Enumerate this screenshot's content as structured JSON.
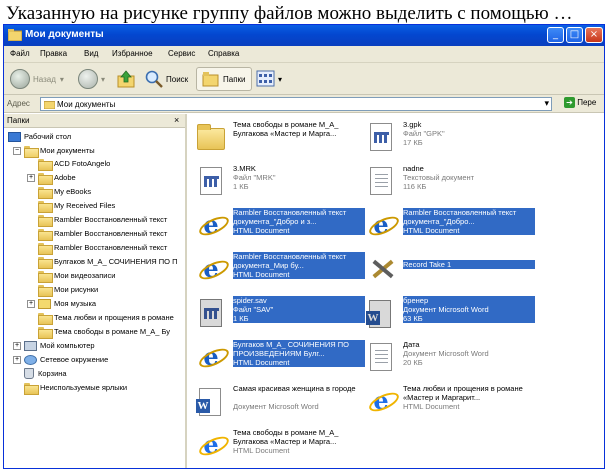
{
  "question": "Указанную на рисунке группу файлов можно выделить с помощью …",
  "window": {
    "title": "Мои документы",
    "controls": {
      "minimize": "_",
      "maximize": "□",
      "close": "×"
    }
  },
  "menu": [
    "Файл",
    "Правка",
    "Вид",
    "Избранное",
    "Сервис",
    "Справка"
  ],
  "toolbar": {
    "back": "Назад",
    "search": "Поиск",
    "folders": "Папки"
  },
  "address": {
    "label": "Адрес",
    "value": "Мои документы",
    "go": "Пере"
  },
  "left_pane": {
    "title": "Папки",
    "close": "×",
    "tree": [
      "Рабочий стол",
      "Мои документы",
      "ACD FotoAngelo",
      "Adobe",
      "My eBooks",
      "My Received Files",
      "Rambler Восстановленный текст",
      "Rambler Восстановленный текст",
      "Rambler Восстановленный текст",
      "Булгаков М_А_ СОЧИНЕНИЯ ПО П",
      "Мои видеозаписи",
      "Мои рисунки",
      "Моя музыка",
      "Тема любви и прощения в романе",
      "Тема свободы в романе М_А_ Бу",
      "Мой компьютер",
      "Сетевое окружение",
      "Корзина",
      "Неиспользуемые ярлыки"
    ]
  },
  "files": [
    {
      "name": "Тема свободы в романе М_А_ Булгакова «Мастер и Марга...",
      "type": "",
      "size": "",
      "icon": "folder-icon",
      "selected": false
    },
    {
      "name": "3.gpk",
      "type": "Файл \"GPK\"",
      "size": "17 КБ",
      "icon": "grid-file-icon",
      "selected": false
    },
    {
      "name": "3.MRK",
      "type": "Файл \"MRK\"",
      "size": "1 КБ",
      "icon": "grid-file-icon",
      "selected": false
    },
    {
      "name": "nadne",
      "type": "Текстовый документ",
      "size": "116 КБ",
      "icon": "text-file-icon",
      "selected": false
    },
    {
      "name": "Rambler Восстановленный текст документа_\"Добро и з...",
      "type": "HTML Document",
      "size": "",
      "icon": "ie-icon",
      "selected": true
    },
    {
      "name": "Rambler Восстановленный текст документа_\"Добро...",
      "type": "HTML Document",
      "size": "",
      "icon": "ie-icon",
      "selected": true
    },
    {
      "name": "Rambler Восстановленный текст документа_Мир бу...",
      "type": "HTML Document",
      "size": "",
      "icon": "ie-icon",
      "selected": true
    },
    {
      "name": "Record Take 1",
      "type": "",
      "size": "",
      "icon": "winamp-icon",
      "selected": true
    },
    {
      "name": "spider.sav",
      "type": "Файл \"SAV\"",
      "size": "1 КБ",
      "icon": "grid-file-icon",
      "selected": true
    },
    {
      "name": "бренер",
      "type": "Документ Microsoft Word",
      "size": "63 КБ",
      "icon": "word-icon",
      "selected": true
    },
    {
      "name": "Булгаков М_А_ СОЧИНЕНИЯ ПО ПРОИЗВЕДЕНИЯМ Булг...",
      "type": "HTML Document",
      "size": "",
      "icon": "ie-icon",
      "selected": true
    },
    {
      "name": "Дата",
      "type": "Документ Microsoft Word",
      "size": "20 КБ",
      "icon": "text-file-icon",
      "selected": false
    },
    {
      "name": "Самая красивая женщина в городе",
      "type": "Документ Microsoft Word",
      "size": "",
      "icon": "word-icon",
      "selected": false
    },
    {
      "name": "Тема любви и прощения в романе «Мастер и Маргарит...",
      "type": "HTML Document",
      "size": "",
      "icon": "ie-icon",
      "selected": false
    },
    {
      "name": "Тема свободы в романе М_А_ Булгакова «Мастер и Марга...",
      "type": "HTML Document",
      "size": "",
      "icon": "ie-icon",
      "selected": false
    }
  ]
}
